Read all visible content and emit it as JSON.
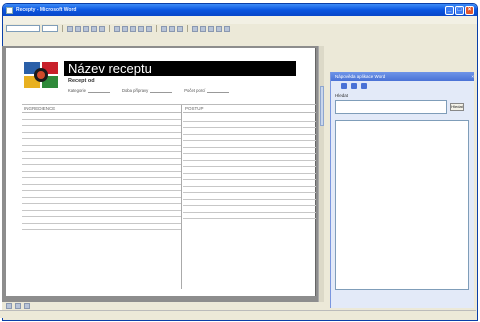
{
  "window": {
    "title": "Recepty - Microsoft Word"
  },
  "recipe": {
    "title": "Název receptu",
    "subtitle": "Recept od",
    "category_label": "Kategorie",
    "prep_label": "Doba přípravy",
    "portions_label": "Počet porcí",
    "ingredients_header": "INGREDIENCE",
    "procedure_header": "POSTUP"
  },
  "taskpane": {
    "title": "Nápověda aplikace Word",
    "search_label": "Hledat",
    "go_label": "Hledat"
  },
  "colors": {
    "title_bg": "#000000",
    "titlebar": "#0a55e0",
    "taskpane_bg": "#e3eaf8"
  }
}
